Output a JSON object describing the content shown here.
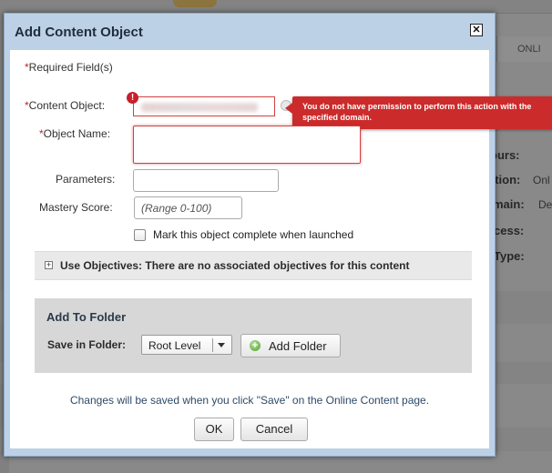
{
  "background": {
    "tab_label": "ONLI",
    "labels": [
      "ours:",
      "ation:",
      "main:",
      "cess:",
      "Type:"
    ],
    "values": [
      "Onl",
      "De"
    ]
  },
  "dialog": {
    "title": "Add Content Object",
    "close_icon": "close-x-icon"
  },
  "form": {
    "required_note": "Required Field(s)",
    "content_object_label": "Content Object:",
    "error_tooltip": "You do not have permission to perform this action with the specified domain.",
    "error_icon": "error-exclamation-icon",
    "object_name_label": "Object Name:",
    "object_name_value": "",
    "parameters_label": "Parameters:",
    "parameters_value": "",
    "mastery_label": "Mastery Score:",
    "mastery_placeholder": "(Range 0-100)",
    "mark_complete_label": "Mark this object complete when launched",
    "mark_complete_checked": false
  },
  "objectives": {
    "text": "Use Objectives: There are no associated objectives for this content",
    "expand_symbol": "+"
  },
  "folder": {
    "title": "Add To Folder",
    "save_in_label": "Save in Folder:",
    "selected": "Root Level",
    "add_folder_label": "Add Folder"
  },
  "footer": {
    "save_note": "Changes will be saved when you click \"Save\" on the Online Content page.",
    "ok_label": "OK",
    "cancel_label": "Cancel"
  },
  "colors": {
    "error_red": "#cc2b2b",
    "titlebar_blue": "#bdd1e6",
    "required_star": "#c8202a"
  }
}
